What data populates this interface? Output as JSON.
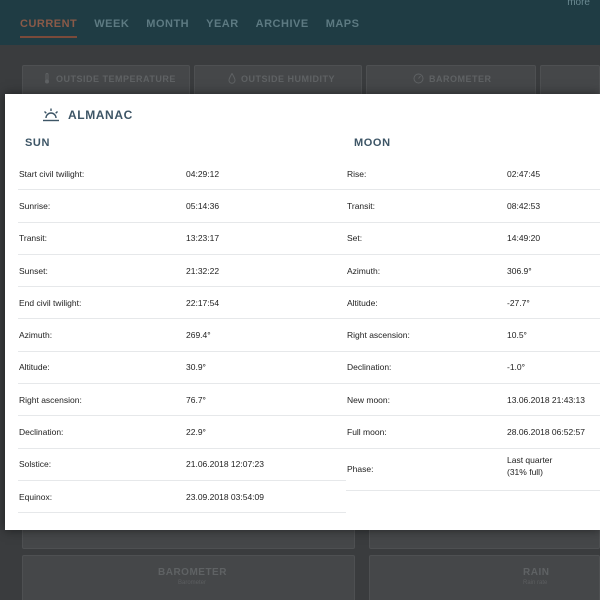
{
  "topbar": {
    "more_label": "more",
    "nav": [
      "CURRENT",
      "WEEK",
      "MONTH",
      "YEAR",
      "ARCHIVE",
      "MAPS"
    ]
  },
  "background_cards": {
    "outside_temperature": "OUTSIDE TEMPERATURE",
    "outside_humidity": "OUTSIDE HUMIDITY",
    "barometer": "BAROMETER",
    "barometer_chart": "BAROMETER",
    "barometer_chart_sub": "Barometer",
    "rain_chart": "RAIN",
    "rain_chart_sub": "Rain rate"
  },
  "almanac": {
    "title": "ALMANAC",
    "sun": {
      "heading": "SUN",
      "rows": [
        {
          "label": "Start civil twilight:",
          "value": "04:29:12"
        },
        {
          "label": "Sunrise:",
          "value": "05:14:36"
        },
        {
          "label": "Transit:",
          "value": "13:23:17"
        },
        {
          "label": "Sunset:",
          "value": "21:32:22"
        },
        {
          "label": "End civil twilight:",
          "value": "22:17:54"
        },
        {
          "label": "Azimuth:",
          "value": "269.4°"
        },
        {
          "label": "Altitude:",
          "value": "30.9°"
        },
        {
          "label": "Right ascension:",
          "value": "76.7°"
        },
        {
          "label": "Declination:",
          "value": "22.9°"
        },
        {
          "label": "Solstice:",
          "value": "21.06.2018 12:07:23"
        },
        {
          "label": "Equinox:",
          "value": "23.09.2018 03:54:09"
        }
      ]
    },
    "moon": {
      "heading": "MOON",
      "rows": [
        {
          "label": "Rise:",
          "value": "02:47:45"
        },
        {
          "label": "Transit:",
          "value": "08:42:53"
        },
        {
          "label": "Set:",
          "value": "14:49:20"
        },
        {
          "label": "Azimuth:",
          "value": "306.9°"
        },
        {
          "label": "Altitude:",
          "value": "-27.7°"
        },
        {
          "label": "Right ascension:",
          "value": "10.5°"
        },
        {
          "label": "Declination:",
          "value": "-1.0°"
        },
        {
          "label": "New moon:",
          "value": "13.06.2018 21:43:13"
        },
        {
          "label": "Full moon:",
          "value": "28.06.2018 06:52:57"
        },
        {
          "label": "Phase:",
          "value": "Last quarter",
          "value2": "(31% full)"
        }
      ]
    }
  },
  "colors": {
    "accent": "#3d5566",
    "active_tab": "#8a5a48"
  }
}
